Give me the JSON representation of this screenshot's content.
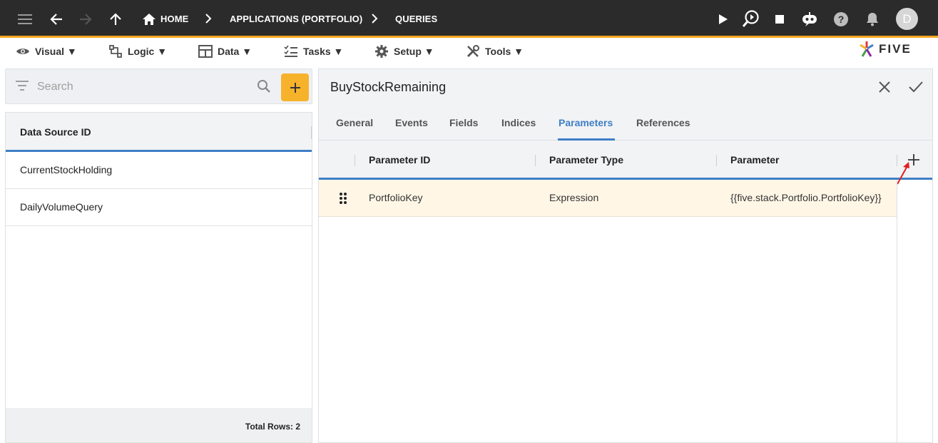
{
  "breadcrumbs": {
    "home": "HOME",
    "applications": "APPLICATIONS (PORTFOLIO)",
    "queries": "QUERIES"
  },
  "user": {
    "avatar_letter": "D"
  },
  "menu": {
    "visual": "Visual ▼",
    "logic": "Logic ▼",
    "data": "Data ▼",
    "tasks": "Tasks ▼",
    "setup": "Setup ▼",
    "tools": "Tools ▼"
  },
  "logo": {
    "text": "FIVE"
  },
  "left_panel": {
    "search_placeholder": "Search",
    "column_header": "Data Source ID",
    "rows": [
      "CurrentStockHolding",
      "DailyVolumeQuery"
    ],
    "footer": "Total Rows: 2"
  },
  "detail": {
    "title": "BuyStockRemaining",
    "tabs": [
      "General",
      "Events",
      "Fields",
      "Indices",
      "Parameters",
      "References"
    ],
    "active_tab": "Parameters",
    "grid": {
      "columns": [
        "Parameter ID",
        "Parameter Type",
        "Parameter"
      ],
      "rows": [
        {
          "parameter_id": "PortfolioKey",
          "parameter_type": "Expression",
          "parameter": "{{five.stack.Portfolio.PortfolioKey}}"
        }
      ]
    }
  },
  "colors": {
    "topbar": "#2b2b2b",
    "accent_orange": "#f7b22c",
    "accent_blue": "#3f7fc6",
    "row_highlight": "#fff6e6",
    "annotation_arrow": "#e02020"
  }
}
